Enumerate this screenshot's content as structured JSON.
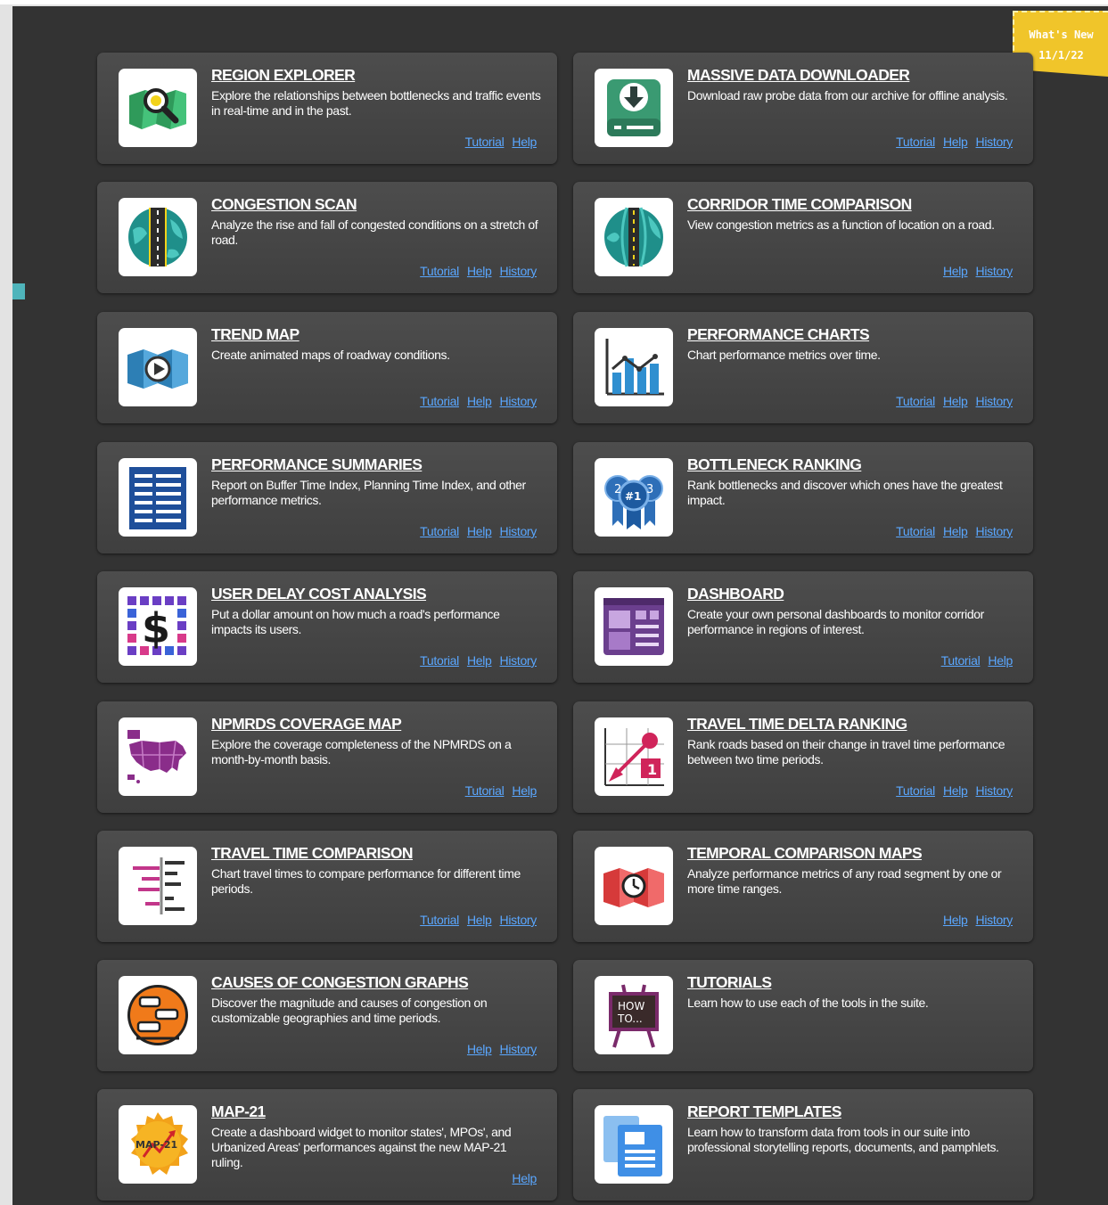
{
  "banner": {
    "line1": "What's New",
    "line2": "11/1/22"
  },
  "colors": {
    "background": "#333333",
    "card": "#474747",
    "link": "#5aa7ff",
    "banner": "#f0c52a"
  },
  "tools": [
    {
      "title": "REGION EXPLORER",
      "desc": "Explore the relationships between bottlenecks and traffic events in real-time and in the past.",
      "tutorial": "Tutorial",
      "help": "Help",
      "history": null,
      "icon": "map-magnifier-icon"
    },
    {
      "title": "MASSIVE DATA DOWNLOADER",
      "desc": "Download raw probe data from our archive for offline analysis.",
      "tutorial": "Tutorial",
      "help": "Help",
      "history": "History",
      "icon": "download-drive-icon"
    },
    {
      "title": "CONGESTION SCAN",
      "desc": "Analyze the rise and fall of congested conditions on a stretch of road.",
      "tutorial": "Tutorial",
      "help": "Help",
      "history": "History",
      "icon": "road-globe-icon"
    },
    {
      "title": "CORRIDOR TIME COMPARISON",
      "desc": "View congestion metrics as a function of location on a road.",
      "tutorial": null,
      "help": "Help",
      "history": "History",
      "icon": "corridor-globe-icon"
    },
    {
      "title": "TREND MAP",
      "desc": "Create animated maps of roadway conditions.",
      "tutorial": "Tutorial",
      "help": "Help",
      "history": "History",
      "icon": "map-play-icon"
    },
    {
      "title": "PERFORMANCE CHARTS",
      "desc": "Chart performance metrics over time.",
      "tutorial": "Tutorial",
      "help": "Help",
      "history": "History",
      "icon": "bar-line-chart-icon"
    },
    {
      "title": "PERFORMANCE SUMMARIES",
      "desc": "Report on Buffer Time Index, Planning Time Index, and other performance metrics.",
      "tutorial": "Tutorial",
      "help": "Help",
      "history": "History",
      "icon": "report-table-icon"
    },
    {
      "title": "BOTTLENECK RANKING",
      "desc": "Rank bottlenecks and discover which ones have the greatest impact.",
      "tutorial": "Tutorial",
      "help": "Help",
      "history": "History",
      "icon": "ribbon-rank-icon"
    },
    {
      "title": "USER DELAY COST ANALYSIS",
      "desc": "Put a dollar amount on how much a road's performance impacts its users.",
      "tutorial": "Tutorial",
      "help": "Help",
      "history": "History",
      "icon": "dollar-grid-icon"
    },
    {
      "title": "DASHBOARD",
      "desc": "Create your own personal dashboards to monitor corridor performance in regions of interest.",
      "tutorial": "Tutorial",
      "help": "Help",
      "history": null,
      "icon": "dashboard-screen-icon"
    },
    {
      "title": "NPMRDS COVERAGE MAP",
      "desc": "Explore the coverage completeness of the NPMRDS on a month-by-month basis.",
      "tutorial": "Tutorial",
      "help": "Help",
      "history": null,
      "icon": "us-map-icon"
    },
    {
      "title": "TRAVEL TIME DELTA RANKING",
      "desc": "Rank roads based on their change in travel time performance between two time periods.",
      "tutorial": "Tutorial",
      "help": "Help",
      "history": "History",
      "icon": "delta-rank-icon"
    },
    {
      "title": "TRAVEL TIME COMPARISON",
      "desc": "Chart travel times to compare performance for different time periods.",
      "tutorial": "Tutorial",
      "help": "Help",
      "history": "History",
      "icon": "comparison-bars-icon"
    },
    {
      "title": "TEMPORAL COMPARISON MAPS",
      "desc": "Analyze performance metrics of any road segment by one or more time ranges.",
      "tutorial": null,
      "help": "Help",
      "history": "History",
      "icon": "map-clock-icon"
    },
    {
      "title": "CAUSES OF CONGESTION GRAPHS",
      "desc": "Discover the magnitude and causes of congestion on customizable geographies and time periods.",
      "tutorial": null,
      "help": "Help",
      "history": "History",
      "icon": "congestion-cars-icon"
    },
    {
      "title": "TUTORIALS",
      "desc": "Learn how to use each of the tools in the suite.",
      "tutorial": null,
      "help": null,
      "history": null,
      "icon": "how-to-easel-icon",
      "icon_text": [
        "HOW",
        "TO..."
      ]
    },
    {
      "title": "MAP-21",
      "desc": "Create a dashboard widget to monitor states', MPOs', and Urbanized Areas' performances against the new MAP-21 ruling.",
      "tutorial": null,
      "help": "Help",
      "history": null,
      "icon": "map21-seal-icon",
      "icon_text": [
        "MAP-21"
      ]
    },
    {
      "title": "REPORT TEMPLATES",
      "desc": "Learn how to transform data from tools in our suite into professional storytelling reports, documents, and pamphlets.",
      "tutorial": null,
      "help": null,
      "history": null,
      "icon": "report-docs-icon"
    }
  ]
}
